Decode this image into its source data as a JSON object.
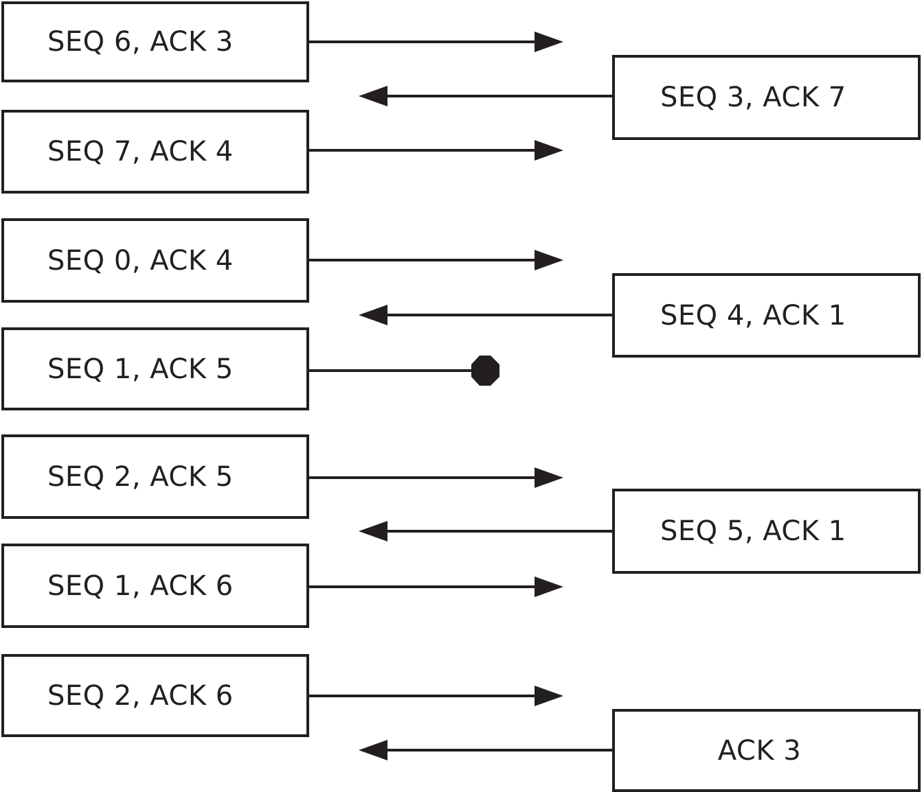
{
  "diagram": {
    "type": "sequence-exchange",
    "colors": {
      "ink": "#231f20",
      "background": "#ffffff"
    },
    "left_frames": [
      {
        "label": "SEQ 6, ACK 3",
        "arrow": "right"
      },
      {
        "label": "SEQ 7, ACK 4",
        "arrow": "right"
      },
      {
        "label": "SEQ 0, ACK 4",
        "arrow": "right"
      },
      {
        "label": "SEQ 1, ACK 5",
        "arrow": "lost"
      },
      {
        "label": "SEQ 2, ACK 5",
        "arrow": "right"
      },
      {
        "label": "SEQ 1, ACK 6",
        "arrow": "right"
      },
      {
        "label": "SEQ 2, ACK 6",
        "arrow": "right"
      }
    ],
    "right_frames": [
      {
        "label": "SEQ 3, ACK 7",
        "arrow": "left"
      },
      {
        "label": "SEQ 4, ACK 1",
        "arrow": "left"
      },
      {
        "label": "SEQ 5, ACK 1",
        "arrow": "left"
      },
      {
        "label": "ACK 3",
        "arrow": "left"
      }
    ]
  }
}
